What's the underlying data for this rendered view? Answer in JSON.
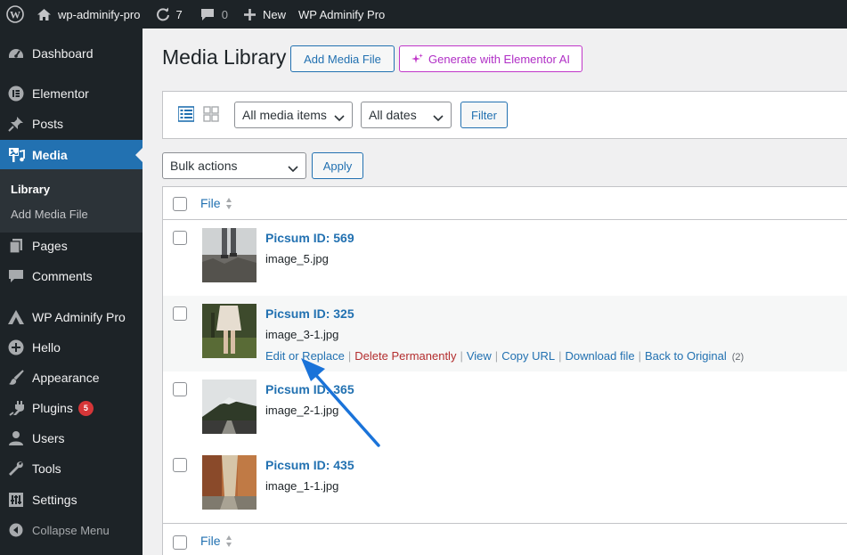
{
  "adminbar": {
    "site_name": "wp-adminify-pro",
    "updates_count": "7",
    "comments_count": "0",
    "new_label": "New",
    "plugin_label": "WP Adminify Pro"
  },
  "sidebar": {
    "items": [
      {
        "label": "Dashboard",
        "icon": "dashboard-icon"
      },
      {
        "label": "Elementor",
        "icon": "elementor-icon"
      },
      {
        "label": "Posts",
        "icon": "pin-icon"
      },
      {
        "label": "Media",
        "icon": "media-icon"
      },
      {
        "label": "Pages",
        "icon": "pages-icon"
      },
      {
        "label": "Comments",
        "icon": "comment-icon"
      },
      {
        "label": "WP Adminify Pro",
        "icon": "adminify-icon"
      },
      {
        "label": "Hello",
        "icon": "plus-circle-icon"
      },
      {
        "label": "Appearance",
        "icon": "brush-icon"
      },
      {
        "label": "Plugins",
        "icon": "plug-icon",
        "badge": "5"
      },
      {
        "label": "Users",
        "icon": "user-icon"
      },
      {
        "label": "Tools",
        "icon": "wrench-icon"
      },
      {
        "label": "Settings",
        "icon": "settings-icon"
      }
    ],
    "submenu": [
      "Library",
      "Add Media File"
    ],
    "collapse_label": "Collapse Menu"
  },
  "main": {
    "title": "Media Library",
    "add_button": "Add Media File",
    "ai_button": "Generate with Elementor AI",
    "filters": {
      "type_select": "All media items",
      "date_select": "All dates",
      "filter_button": "Filter"
    },
    "bulk": {
      "select": "Bulk actions",
      "apply_button": "Apply"
    },
    "table": {
      "column_header": "File",
      "rows": [
        {
          "title": "Picsum ID: 569",
          "file": "image_5.jpg"
        },
        {
          "title": "Picsum ID: 325",
          "file": "image_3-1.jpg",
          "actions": [
            "Edit or Replace",
            "Delete Permanently",
            "View",
            "Copy URL",
            "Download file",
            "Back to Original"
          ],
          "action_count": "(2)"
        },
        {
          "title": "Picsum ID: 365",
          "file": "image_2-1.jpg"
        },
        {
          "title": "Picsum ID: 435",
          "file": "image_1-1.jpg"
        }
      ]
    }
  },
  "colors": {
    "accent": "#2271b1",
    "sidebar_bg": "#1d2327",
    "active_bg": "#2271b1",
    "ai_purple": "#c036c9",
    "danger": "#b32d2e",
    "arrow": "#1a73d9"
  }
}
